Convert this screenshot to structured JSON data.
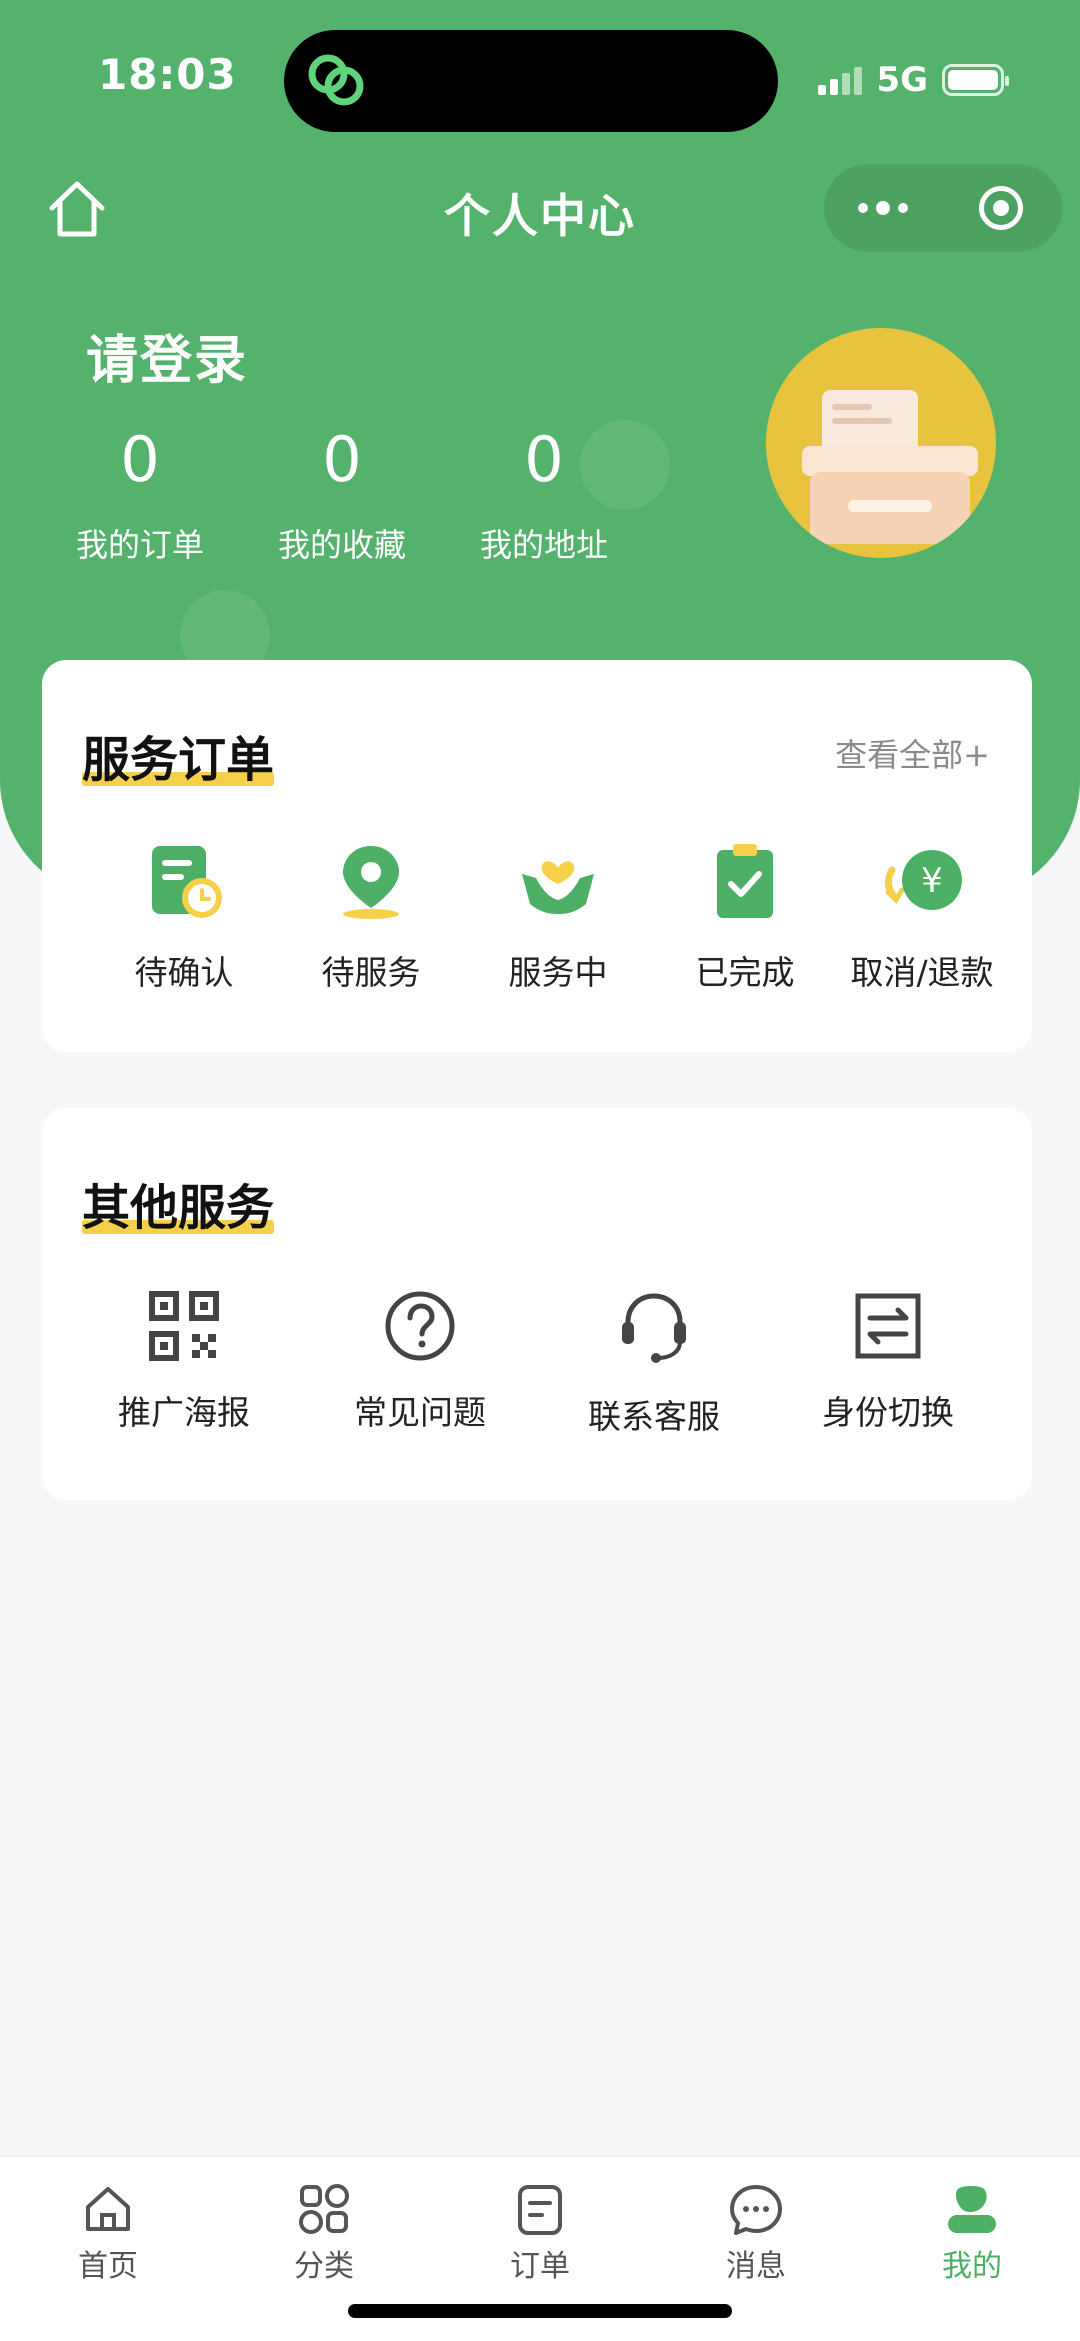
{
  "status_bar": {
    "time": "18:03",
    "network": "5G"
  },
  "nav": {
    "title": "个人中心"
  },
  "profile": {
    "login_prompt": "请登录",
    "stats": [
      {
        "value": "0",
        "label": "我的订单"
      },
      {
        "value": "0",
        "label": "我的收藏"
      },
      {
        "value": "0",
        "label": "我的地址"
      }
    ]
  },
  "service_orders": {
    "title": "服务订单",
    "view_all": "查看全部+",
    "items": [
      {
        "label": "待确认",
        "icon": "doc-clock-icon"
      },
      {
        "label": "待服务",
        "icon": "location-pin-icon"
      },
      {
        "label": "服务中",
        "icon": "hands-heart-icon"
      },
      {
        "label": "已完成",
        "icon": "clipboard-check-icon"
      },
      {
        "label": "取消/退款",
        "icon": "yen-refund-icon"
      }
    ]
  },
  "other_services": {
    "title": "其他服务",
    "items": [
      {
        "label": "推广海报",
        "icon": "qr-code-icon"
      },
      {
        "label": "常见问题",
        "icon": "question-icon"
      },
      {
        "label": "联系客服",
        "icon": "headset-icon"
      },
      {
        "label": "身份切换",
        "icon": "switch-icon"
      }
    ]
  },
  "tabbar": {
    "items": [
      {
        "label": "首页",
        "icon": "home-icon"
      },
      {
        "label": "分类",
        "icon": "category-icon"
      },
      {
        "label": "订单",
        "icon": "order-icon"
      },
      {
        "label": "消息",
        "icon": "message-icon"
      },
      {
        "label": "我的",
        "icon": "user-icon"
      }
    ],
    "active": "我的"
  },
  "colors": {
    "primary": "#55b26c",
    "accent": "#f6d04a",
    "avatar_bg": "#e8c33d",
    "active_tab": "#4caf65"
  }
}
